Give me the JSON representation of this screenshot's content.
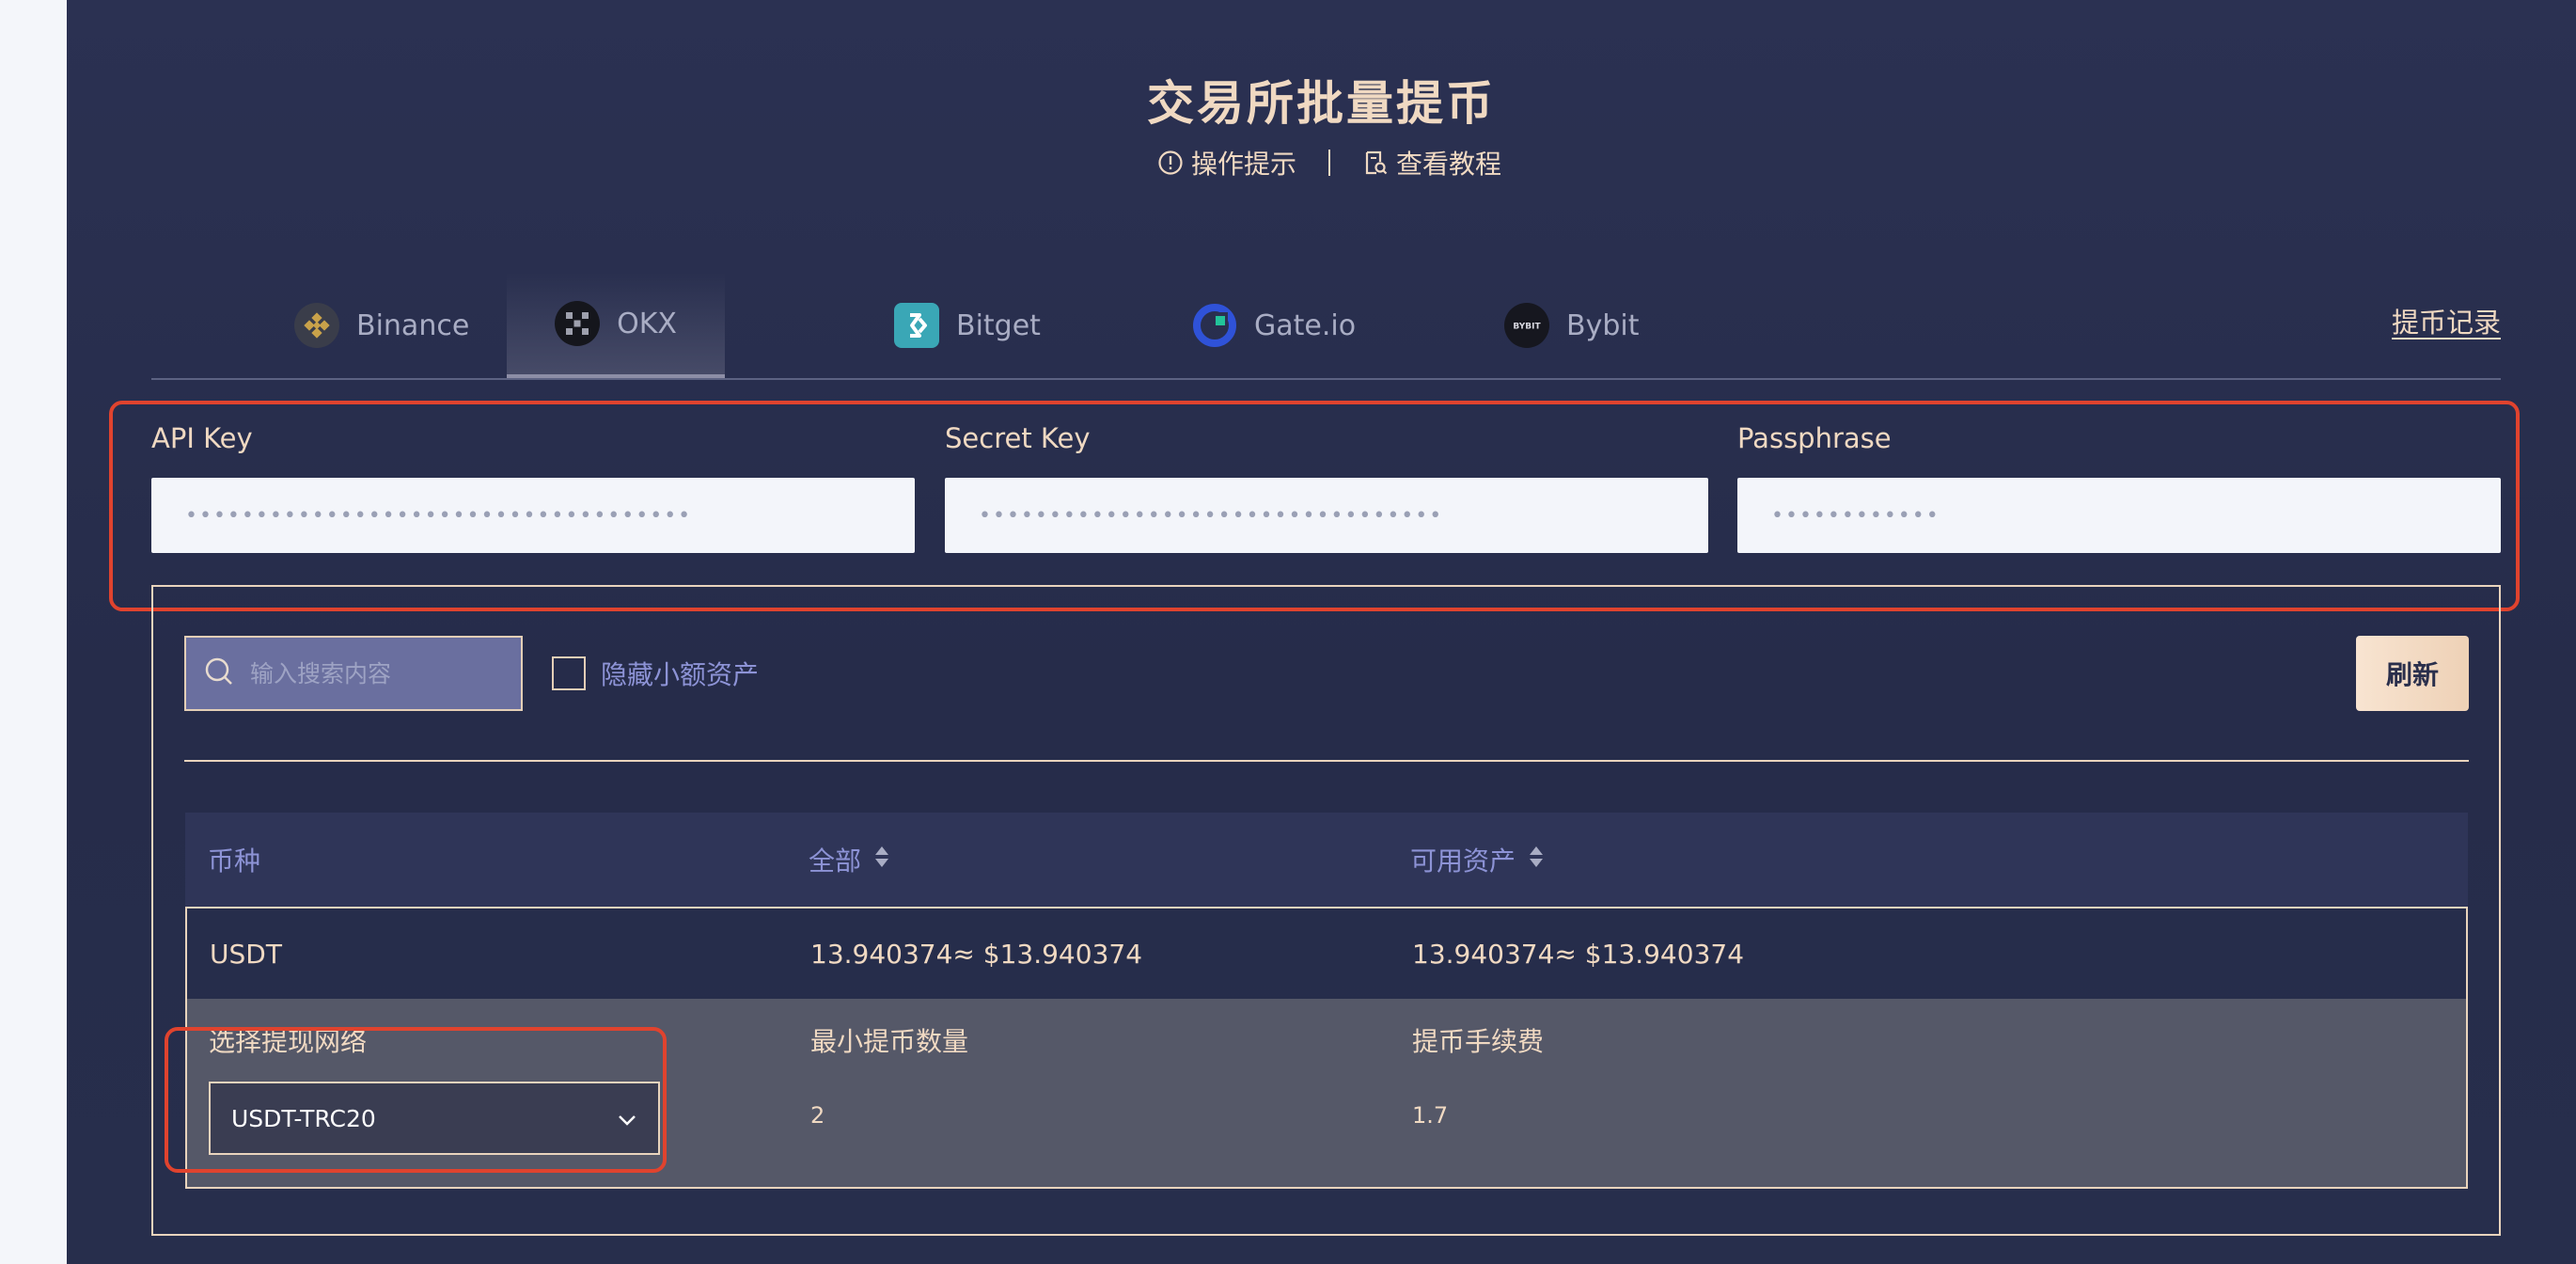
{
  "header": {
    "title": "交易所批量提币",
    "tips_label": "操作提示",
    "tutorial_label": "查看教程"
  },
  "tabs": [
    {
      "label": "Binance",
      "icon": "binance-icon",
      "active": false
    },
    {
      "label": "OKX",
      "icon": "okx-icon",
      "active": true
    },
    {
      "label": "Bitget",
      "icon": "bitget-icon",
      "active": false
    },
    {
      "label": "Gate.io",
      "icon": "gateio-icon",
      "active": false
    },
    {
      "label": "Bybit",
      "icon": "bybit-icon",
      "active": false
    }
  ],
  "history_link": "提币记录",
  "keys": {
    "api_key": {
      "label": "API Key",
      "value": "••••••••••••••••••••••••••••••••••••"
    },
    "secret_key": {
      "label": "Secret Key",
      "value": "•••••••••••••••••••••••••••••••••"
    },
    "passphrase": {
      "label": "Passphrase",
      "value": "••••••••••••"
    }
  },
  "toolbar": {
    "search_placeholder": "输入搜索内容",
    "hide_small_label": "隐藏小额资产",
    "hide_small_checked": false,
    "refresh_label": "刷新"
  },
  "table": {
    "headers": [
      "币种",
      "全部",
      "可用资产"
    ],
    "rows": [
      {
        "coin": "USDT",
        "total": "13.940374≈ $13.940374",
        "available": "13.940374≈ $13.940374"
      }
    ]
  },
  "detail": {
    "network_label": "选择提现网络",
    "network_value": "USDT-TRC20",
    "min_label": "最小提币数量",
    "min_value": "2",
    "fee_label": "提币手续费",
    "fee_value": "1.7"
  },
  "colors": {
    "background": "#2b3152",
    "accent_text": "#f0d9c2",
    "muted_blue": "#8d93d6",
    "highlight_red": "#e0432e"
  }
}
